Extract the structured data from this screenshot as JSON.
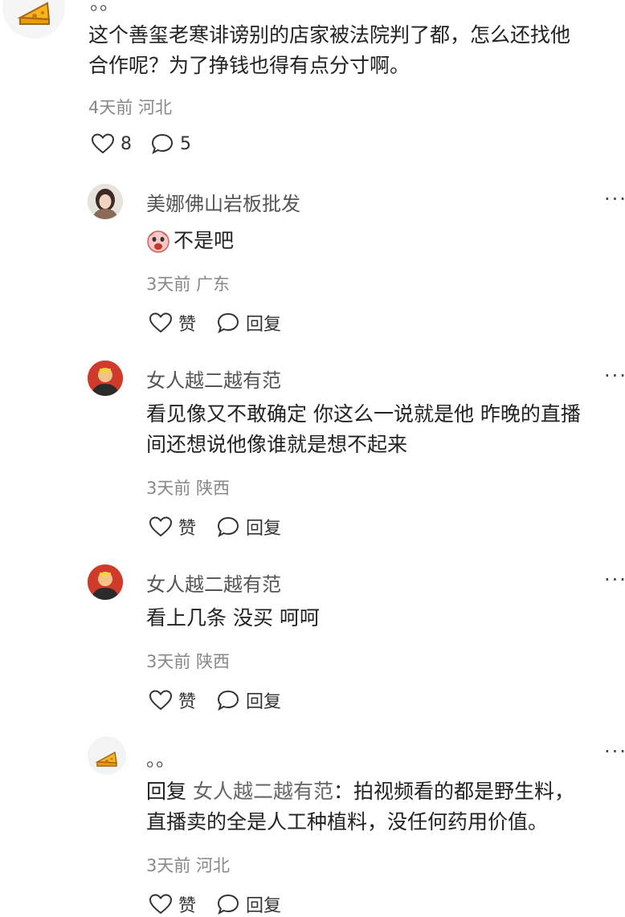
{
  "top_comment": {
    "name": "。。",
    "text_line1": "这个善玺老寒诽谤别的店家被法院判了都，怎么还找他",
    "text_line2": "合作呢？为了挣钱也得有点分寸啊。",
    "meta": "4天前 河北",
    "like_count": "8",
    "reply_count": "5"
  },
  "replies": [
    {
      "name": "美娜佛山岩板批发",
      "text_line1": "不是吧",
      "meta": "3天前 广东",
      "like_label": "赞",
      "reply_label": "回复",
      "more": "···"
    },
    {
      "name": "女人越二越有范",
      "text_line1": "看见像又不敢确定 你这么一说就是他 昨晚的直播",
      "text_line2": "间还想说他像谁就是想不起来",
      "meta": "3天前 陕西",
      "like_label": "赞",
      "reply_label": "回复",
      "more": "···"
    },
    {
      "name": "女人越二越有范",
      "text_line1": "看上几条 没买 呵呵",
      "meta": "3天前 陕西",
      "like_label": "赞",
      "reply_label": "回复",
      "more": "···"
    },
    {
      "name": "。。",
      "reply_prefix": "回复",
      "reply_to": "女人越二越有范",
      "reply_colon": "：",
      "text_line1": "拍视频看的都是野生料，",
      "text_line2": "直播卖的全是人工种植料，没任何药用价值。",
      "meta": "3天前 河北",
      "like_label": "赞",
      "reply_label": "回复",
      "more": "···"
    }
  ]
}
